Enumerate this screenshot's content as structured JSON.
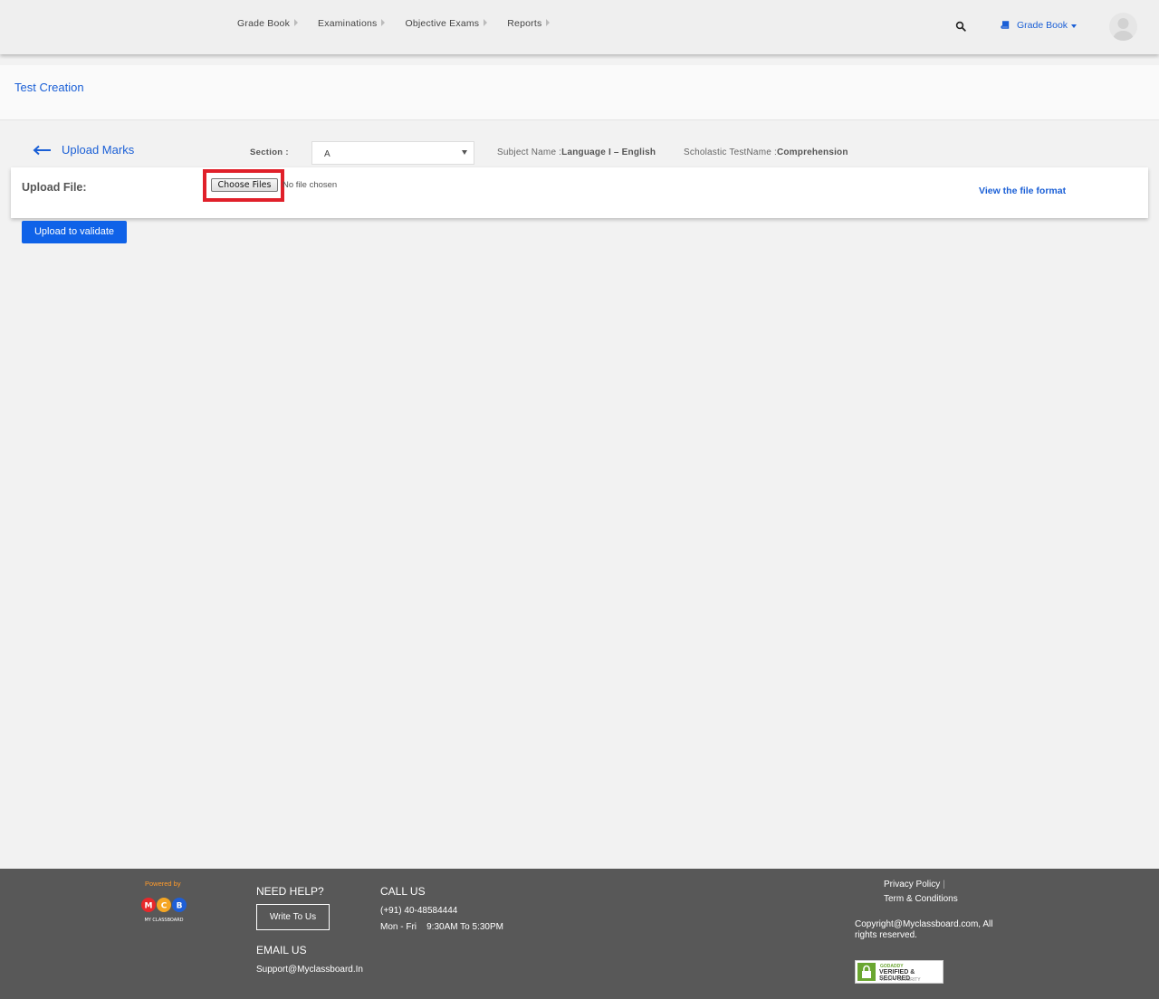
{
  "nav": {
    "items": [
      {
        "label": "Grade Book"
      },
      {
        "label": "Examinations"
      },
      {
        "label": "Objective Exams"
      },
      {
        "label": "Reports"
      }
    ],
    "search_icon": "search-icon",
    "module_label": "Grade Book",
    "module_icon": "book-icon"
  },
  "page": {
    "title": "Test Creation"
  },
  "filters": {
    "back_label": "Upload Marks",
    "section_label": "Section :",
    "section_value": "A",
    "subject_label": "Subject Name :",
    "subject_value": "Language I – English",
    "test_label": "Scholastic TestName :",
    "test_value": "Comprehension"
  },
  "upload": {
    "label": "Upload File:",
    "choose_label": "Choose Files",
    "no_file_text": "No file chosen",
    "view_format_label": "View the file format",
    "validate_label": "Upload to validate"
  },
  "footer": {
    "powered_by": "Powered by",
    "logo_letters": [
      "M",
      "C",
      "B"
    ],
    "logo_caption": "MY CLASSBOARD",
    "need_help": "NEED HELP?",
    "write_to_us": "Write To Us",
    "email_head": "EMAIL US",
    "email": "Support@Myclassboard.In",
    "call_head": "CALL US",
    "phone": "(+91) 40-48584444",
    "hours": "Mon - Fri    9:30AM To 5:30PM",
    "privacy": "Privacy Policy",
    "privacy_sep": "|",
    "terms": "Term & Conditions",
    "copyright": "Copyright@Myclassboard.com, All rights reserved.",
    "seal_top": "GODADDY",
    "seal_mid": "VERIFIED & SECURED",
    "seal_bot": "VERIFY SECURITY"
  },
  "colors": {
    "accent": "#1a5fd6",
    "button": "#0f62e8",
    "highlight": "#e0202a",
    "footer_bg": "#585858",
    "logo_m": "#e8282b",
    "logo_c": "#f5a623",
    "logo_b": "#1f5fd6"
  }
}
